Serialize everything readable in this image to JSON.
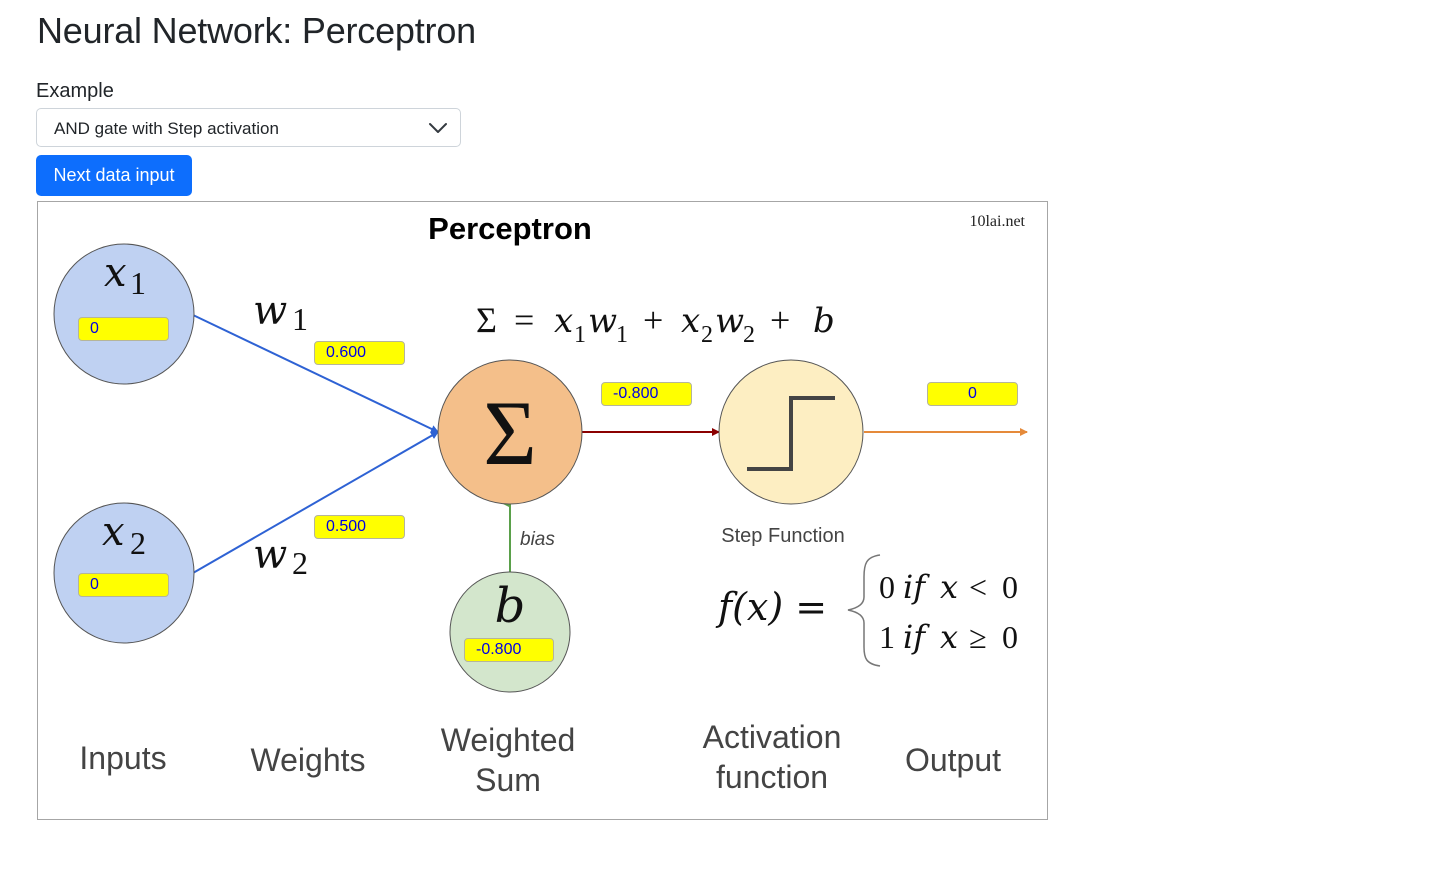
{
  "page": {
    "title": "Neural Network: Perceptron"
  },
  "controls": {
    "example_label": "Example",
    "example_selected": "AND gate with Step activation",
    "next_button_label": "Next data input"
  },
  "diagram": {
    "title": "Perceptron",
    "watermark": "10lai.net",
    "formula": {
      "lhs": "Σ",
      "eq": "=",
      "parts": [
        "x",
        "1",
        "w",
        "1",
        "+",
        "x",
        "2",
        "w",
        "2",
        "+",
        "b"
      ]
    },
    "nodes": {
      "x1": {
        "symbol": "x",
        "subscript": "1",
        "value": "0"
      },
      "x2": {
        "symbol": "x",
        "subscript": "2",
        "value": "0"
      },
      "sum": {
        "symbol": "Σ"
      },
      "bias": {
        "symbol": "b",
        "value": "-0.800",
        "edge_label": "bias"
      },
      "step": {
        "caption": "Step Function"
      }
    },
    "weights": {
      "w1": {
        "symbol": "w",
        "subscript": "1",
        "value": "0.600"
      },
      "w2": {
        "symbol": "w",
        "subscript": "2",
        "value": "0.500"
      }
    },
    "weighted_sum_value": "-0.800",
    "output_value": "0",
    "step_function": {
      "lhs": "f(x) =",
      "case1": {
        "val": "0",
        "cond_kw": "if",
        "var": "x",
        "op": "<",
        "rhs": "0"
      },
      "case2": {
        "val": "1",
        "cond_kw": "if",
        "var": "x",
        "op": "≥",
        "rhs": "0"
      }
    },
    "stage_labels": {
      "inputs": "Inputs",
      "weights": "Weights",
      "weighted_sum_1": "Weighted",
      "weighted_sum_2": "Sum",
      "activation_1": "Activation",
      "activation_2": "function",
      "output": "Output"
    },
    "colors": {
      "input_fill": "#bfd1f2",
      "sum_fill": "#f4bf8a",
      "step_fill": "#fdeec2",
      "bias_fill": "#d3e6cc",
      "weight_edge": "#2e62d4",
      "sum_edge": "#8b0000",
      "output_edge": "#e58a3a",
      "bias_edge": "#5aa04a",
      "value_box": "#ffff00",
      "value_text": "#0000e6",
      "button": "#0d6efd"
    }
  }
}
